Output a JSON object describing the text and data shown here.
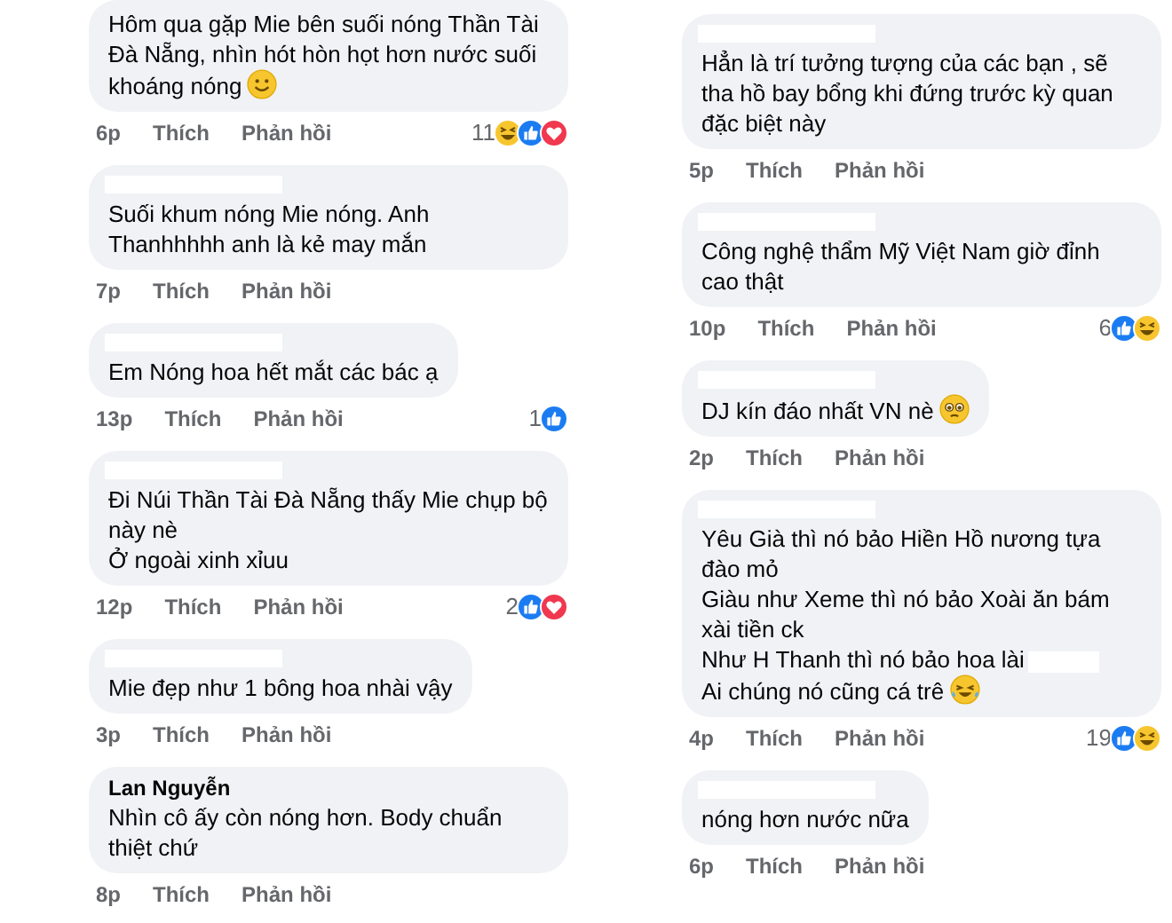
{
  "columns": [
    {
      "comments": [
        {
          "name_redacted": false,
          "paragraphs": [
            {
              "text": "Hôm qua gặp Mie bên suối nóng Thần Tài Đà Nẵng, nhìn hót hòn họt hơn nước suối khoáng nóng",
              "emoji": {
                "kind": "smile"
              }
            }
          ],
          "time": "6p",
          "like": "Thích",
          "reply": "Phản hồi",
          "reactions": {
            "count": "11",
            "icons": [
              {
                "kind": "haha"
              },
              {
                "kind": "like"
              },
              {
                "kind": "love"
              }
            ]
          }
        },
        {
          "name_redacted": true,
          "paragraphs": [
            {
              "text": "Suối khum nóng Mie nóng. Anh Thanhhhhh anh là kẻ may mắn"
            }
          ],
          "time": "7p",
          "like": "Thích",
          "reply": "Phản hồi"
        },
        {
          "name_redacted": true,
          "paragraphs": [
            {
              "text": "Em Nóng hoa hết mắt các bác ạ"
            }
          ],
          "time": "13p",
          "like": "Thích",
          "reply": "Phản hồi",
          "reactions": {
            "count": "1",
            "icons": [
              {
                "kind": "like"
              }
            ]
          }
        },
        {
          "name_redacted": true,
          "paragraphs": [
            {
              "text": "Đi Núi Thần Tài Đà Nẵng thấy Mie chụp bộ này nè"
            },
            {
              "text": "Ở ngoài xinh xỉuu"
            }
          ],
          "time": "12p",
          "like": "Thích",
          "reply": "Phản hồi",
          "reactions": {
            "count": "2",
            "icons": [
              {
                "kind": "like"
              },
              {
                "kind": "love"
              }
            ]
          }
        },
        {
          "name_redacted": true,
          "paragraphs": [
            {
              "text": "Mie đẹp như 1 bông hoa nhài vậy"
            }
          ],
          "time": "3p",
          "like": "Thích",
          "reply": "Phản hồi"
        },
        {
          "name_redacted": false,
          "author": "Lan Nguyễn",
          "paragraphs": [
            {
              "text": "Nhìn cô ấy còn nóng hơn. Body chuẩn thiệt chứ"
            }
          ],
          "time": "8p",
          "like": "Thích",
          "reply": "Phản hồi"
        }
      ]
    },
    {
      "comments": [
        {
          "name_redacted": true,
          "paragraphs": [
            {
              "text": "Hẳn là trí tưởng tượng của các bạn , sẽ tha hồ bay bổng khi đứng trước kỳ quan đặc biệt này"
            }
          ],
          "time": "5p",
          "like": "Thích",
          "reply": "Phản hồi"
        },
        {
          "name_redacted": true,
          "paragraphs": [
            {
              "text": "Công nghệ thẩm Mỹ Việt Nam giờ đỉnh cao thật"
            }
          ],
          "time": "10p",
          "like": "Thích",
          "reply": "Phản hồi",
          "reactions": {
            "count": "6",
            "icons": [
              {
                "kind": "like"
              },
              {
                "kind": "haha"
              }
            ]
          }
        },
        {
          "name_redacted": true,
          "paragraphs": [
            {
              "text": "DJ kín đáo nhất VN nè",
              "emoji": {
                "kind": "pleading"
              }
            }
          ],
          "time": "2p",
          "like": "Thích",
          "reply": "Phản hồi"
        },
        {
          "name_redacted": true,
          "paragraphs": [
            {
              "text": "Yêu Già thì nó bảo Hiền Hồ nương tựa đào mỏ"
            },
            {
              "text": "Giàu như Xeme thì nó bảo Xoài ăn bám xài tiền ck"
            },
            {
              "text": "Như H Thanh thì nó bảo hoa lài",
              "redacted_after": true
            },
            {
              "text": "Ai chúng nó cũng cá trê",
              "emoji": {
                "kind": "tears"
              }
            }
          ],
          "time": "4p",
          "like": "Thích",
          "reply": "Phản hồi",
          "reactions": {
            "count": "19",
            "icons": [
              {
                "kind": "like"
              },
              {
                "kind": "haha"
              }
            ]
          }
        },
        {
          "name_redacted": true,
          "paragraphs": [
            {
              "text": "nóng hơn nước nữa"
            }
          ],
          "time": "6p",
          "like": "Thích",
          "reply": "Phản hồi"
        }
      ]
    }
  ]
}
